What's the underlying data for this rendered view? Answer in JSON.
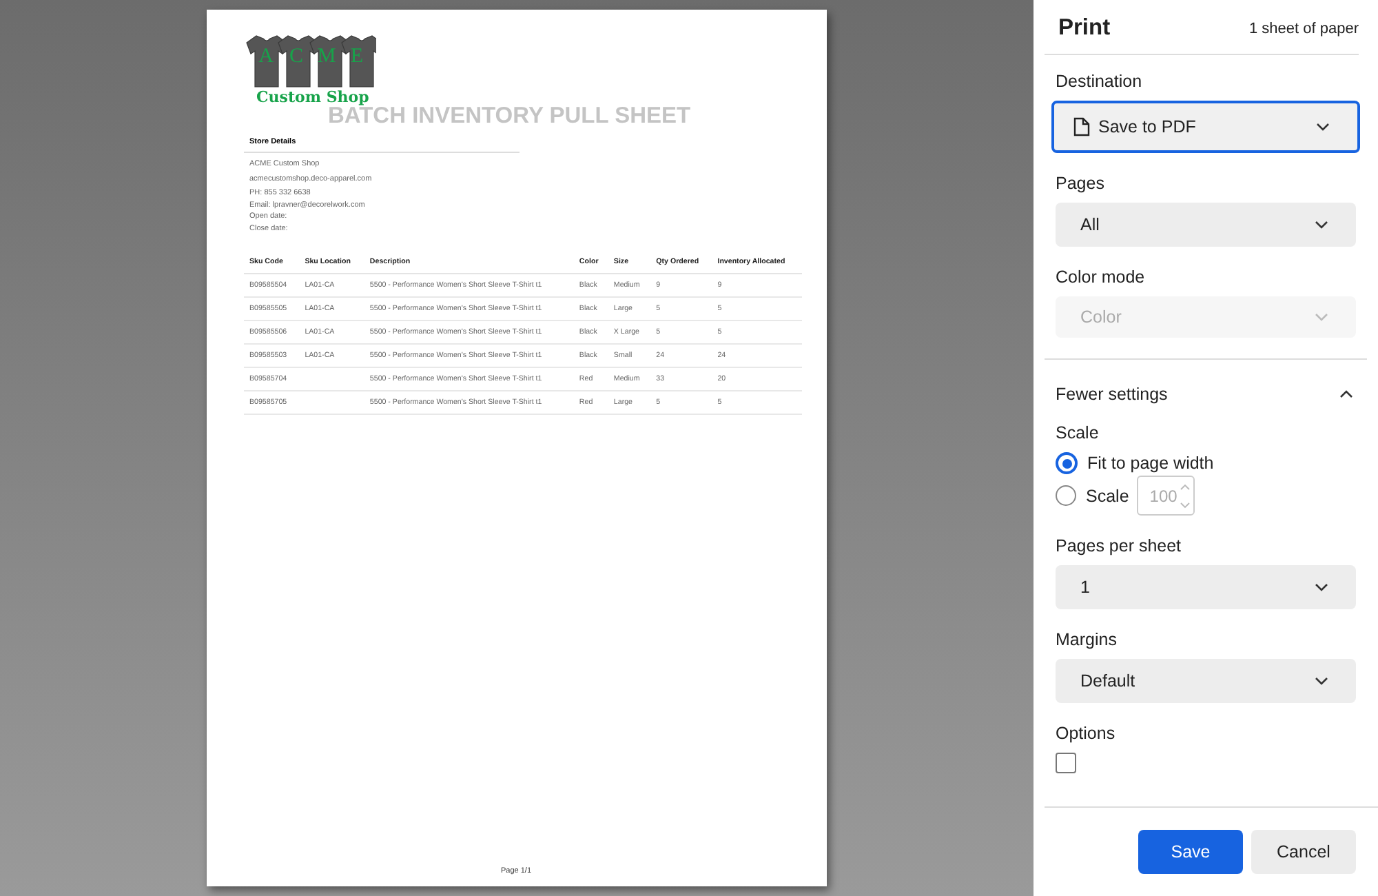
{
  "document": {
    "logo": {
      "letters": [
        "A",
        "C",
        "M",
        "E"
      ],
      "name": "Custom Shop"
    },
    "title": "BATCH INVENTORY PULL SHEET",
    "store_details": {
      "heading": "Store Details",
      "lines": [
        "ACME Custom Shop",
        "acmecustomshop.deco-apparel.com"
      ],
      "contact": [
        "PH: 855 332 6638",
        "Email: lpravner@decorelwork.com",
        "Open date:",
        "Close date:"
      ]
    },
    "table": {
      "columns": [
        "Sku Code",
        "Sku Location",
        "Description",
        "Color",
        "Size",
        "Qty Ordered",
        "Inventory Allocated"
      ],
      "rows": [
        [
          "B09585504",
          "LA01-CA",
          "5500 - Performance Women's Short Sleeve T-Shirt t1",
          "Black",
          "Medium",
          "9",
          "9"
        ],
        [
          "B09585505",
          "LA01-CA",
          "5500 - Performance Women's Short Sleeve T-Shirt t1",
          "Black",
          "Large",
          "5",
          "5"
        ],
        [
          "B09585506",
          "LA01-CA",
          "5500 - Performance Women's Short Sleeve T-Shirt t1",
          "Black",
          "X Large",
          "5",
          "5"
        ],
        [
          "B09585503",
          "LA01-CA",
          "5500 - Performance Women's Short Sleeve T-Shirt t1",
          "Black",
          "Small",
          "24",
          "24"
        ],
        [
          "B09585704",
          "",
          "5500 - Performance Women's Short Sleeve T-Shirt t1",
          "Red",
          "Medium",
          "33",
          "20"
        ],
        [
          "B09585705",
          "",
          "5500 - Performance Women's Short Sleeve T-Shirt t1",
          "Red",
          "Large",
          "5",
          "5"
        ]
      ]
    },
    "footer": "Page 1/1"
  },
  "print_panel": {
    "title": "Print",
    "sheets": "1 sheet of paper",
    "sections": [
      {
        "kind": "select",
        "label": "Destination",
        "value": "Save to PDF",
        "focused": true,
        "disabled": false,
        "file_icon": true
      },
      {
        "kind": "select",
        "label": "Pages",
        "value": "All",
        "focused": false,
        "disabled": false
      },
      {
        "kind": "select",
        "label": "Color mode",
        "value": "Color",
        "focused": false,
        "disabled": true
      },
      {
        "kind": "toggle",
        "label": "Fewer settings",
        "expanded": true
      },
      {
        "kind": "radios",
        "label": "Scale",
        "options": [
          {
            "label": "Fit to page width",
            "selected": true
          },
          {
            "label": "Scale",
            "selected": false,
            "input": "100"
          }
        ]
      },
      {
        "kind": "select",
        "label": "Pages per sheet",
        "value": "1",
        "focused": false,
        "disabled": false
      },
      {
        "kind": "select",
        "label": "Margins",
        "value": "Default",
        "focused": false,
        "disabled": false
      },
      {
        "kind": "checkbox",
        "label": "Options",
        "checked": false
      }
    ],
    "buttons": [
      {
        "label": "Save",
        "primary": true
      },
      {
        "label": "Cancel",
        "primary": false
      }
    ]
  }
}
